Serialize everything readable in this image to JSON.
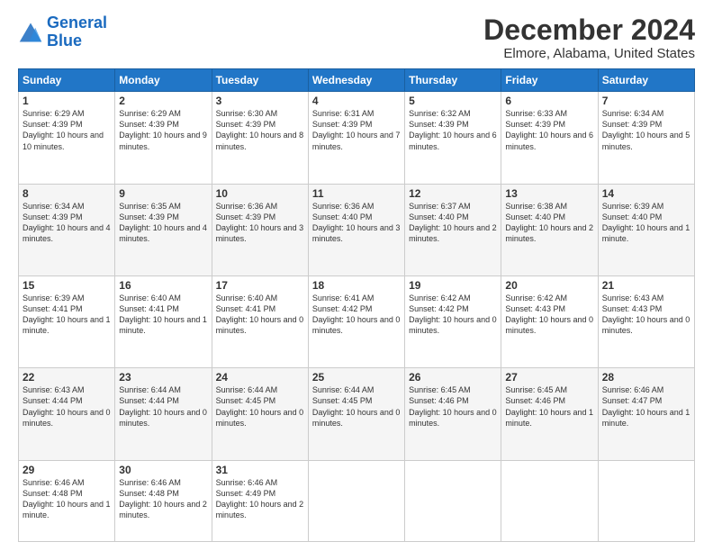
{
  "logo": {
    "line1": "General",
    "line2": "Blue"
  },
  "title": "December 2024",
  "subtitle": "Elmore, Alabama, United States",
  "days": [
    "Sunday",
    "Monday",
    "Tuesday",
    "Wednesday",
    "Thursday",
    "Friday",
    "Saturday"
  ],
  "weeks": [
    [
      {
        "num": "1",
        "sunrise": "6:29 AM",
        "sunset": "4:39 PM",
        "daylight": "10 hours and 10 minutes."
      },
      {
        "num": "2",
        "sunrise": "6:29 AM",
        "sunset": "4:39 PM",
        "daylight": "10 hours and 9 minutes."
      },
      {
        "num": "3",
        "sunrise": "6:30 AM",
        "sunset": "4:39 PM",
        "daylight": "10 hours and 8 minutes."
      },
      {
        "num": "4",
        "sunrise": "6:31 AM",
        "sunset": "4:39 PM",
        "daylight": "10 hours and 7 minutes."
      },
      {
        "num": "5",
        "sunrise": "6:32 AM",
        "sunset": "4:39 PM",
        "daylight": "10 hours and 6 minutes."
      },
      {
        "num": "6",
        "sunrise": "6:33 AM",
        "sunset": "4:39 PM",
        "daylight": "10 hours and 6 minutes."
      },
      {
        "num": "7",
        "sunrise": "6:34 AM",
        "sunset": "4:39 PM",
        "daylight": "10 hours and 5 minutes."
      }
    ],
    [
      {
        "num": "8",
        "sunrise": "6:34 AM",
        "sunset": "4:39 PM",
        "daylight": "10 hours and 4 minutes."
      },
      {
        "num": "9",
        "sunrise": "6:35 AM",
        "sunset": "4:39 PM",
        "daylight": "10 hours and 4 minutes."
      },
      {
        "num": "10",
        "sunrise": "6:36 AM",
        "sunset": "4:39 PM",
        "daylight": "10 hours and 3 minutes."
      },
      {
        "num": "11",
        "sunrise": "6:36 AM",
        "sunset": "4:40 PM",
        "daylight": "10 hours and 3 minutes."
      },
      {
        "num": "12",
        "sunrise": "6:37 AM",
        "sunset": "4:40 PM",
        "daylight": "10 hours and 2 minutes."
      },
      {
        "num": "13",
        "sunrise": "6:38 AM",
        "sunset": "4:40 PM",
        "daylight": "10 hours and 2 minutes."
      },
      {
        "num": "14",
        "sunrise": "6:39 AM",
        "sunset": "4:40 PM",
        "daylight": "10 hours and 1 minute."
      }
    ],
    [
      {
        "num": "15",
        "sunrise": "6:39 AM",
        "sunset": "4:41 PM",
        "daylight": "10 hours and 1 minute."
      },
      {
        "num": "16",
        "sunrise": "6:40 AM",
        "sunset": "4:41 PM",
        "daylight": "10 hours and 1 minute."
      },
      {
        "num": "17",
        "sunrise": "6:40 AM",
        "sunset": "4:41 PM",
        "daylight": "10 hours and 0 minutes."
      },
      {
        "num": "18",
        "sunrise": "6:41 AM",
        "sunset": "4:42 PM",
        "daylight": "10 hours and 0 minutes."
      },
      {
        "num": "19",
        "sunrise": "6:42 AM",
        "sunset": "4:42 PM",
        "daylight": "10 hours and 0 minutes."
      },
      {
        "num": "20",
        "sunrise": "6:42 AM",
        "sunset": "4:43 PM",
        "daylight": "10 hours and 0 minutes."
      },
      {
        "num": "21",
        "sunrise": "6:43 AM",
        "sunset": "4:43 PM",
        "daylight": "10 hours and 0 minutes."
      }
    ],
    [
      {
        "num": "22",
        "sunrise": "6:43 AM",
        "sunset": "4:44 PM",
        "daylight": "10 hours and 0 minutes."
      },
      {
        "num": "23",
        "sunrise": "6:44 AM",
        "sunset": "4:44 PM",
        "daylight": "10 hours and 0 minutes."
      },
      {
        "num": "24",
        "sunrise": "6:44 AM",
        "sunset": "4:45 PM",
        "daylight": "10 hours and 0 minutes."
      },
      {
        "num": "25",
        "sunrise": "6:44 AM",
        "sunset": "4:45 PM",
        "daylight": "10 hours and 0 minutes."
      },
      {
        "num": "26",
        "sunrise": "6:45 AM",
        "sunset": "4:46 PM",
        "daylight": "10 hours and 0 minutes."
      },
      {
        "num": "27",
        "sunrise": "6:45 AM",
        "sunset": "4:46 PM",
        "daylight": "10 hours and 1 minute."
      },
      {
        "num": "28",
        "sunrise": "6:46 AM",
        "sunset": "4:47 PM",
        "daylight": "10 hours and 1 minute."
      }
    ],
    [
      {
        "num": "29",
        "sunrise": "6:46 AM",
        "sunset": "4:48 PM",
        "daylight": "10 hours and 1 minute."
      },
      {
        "num": "30",
        "sunrise": "6:46 AM",
        "sunset": "4:48 PM",
        "daylight": "10 hours and 2 minutes."
      },
      {
        "num": "31",
        "sunrise": "6:46 AM",
        "sunset": "4:49 PM",
        "daylight": "10 hours and 2 minutes."
      },
      null,
      null,
      null,
      null
    ]
  ]
}
